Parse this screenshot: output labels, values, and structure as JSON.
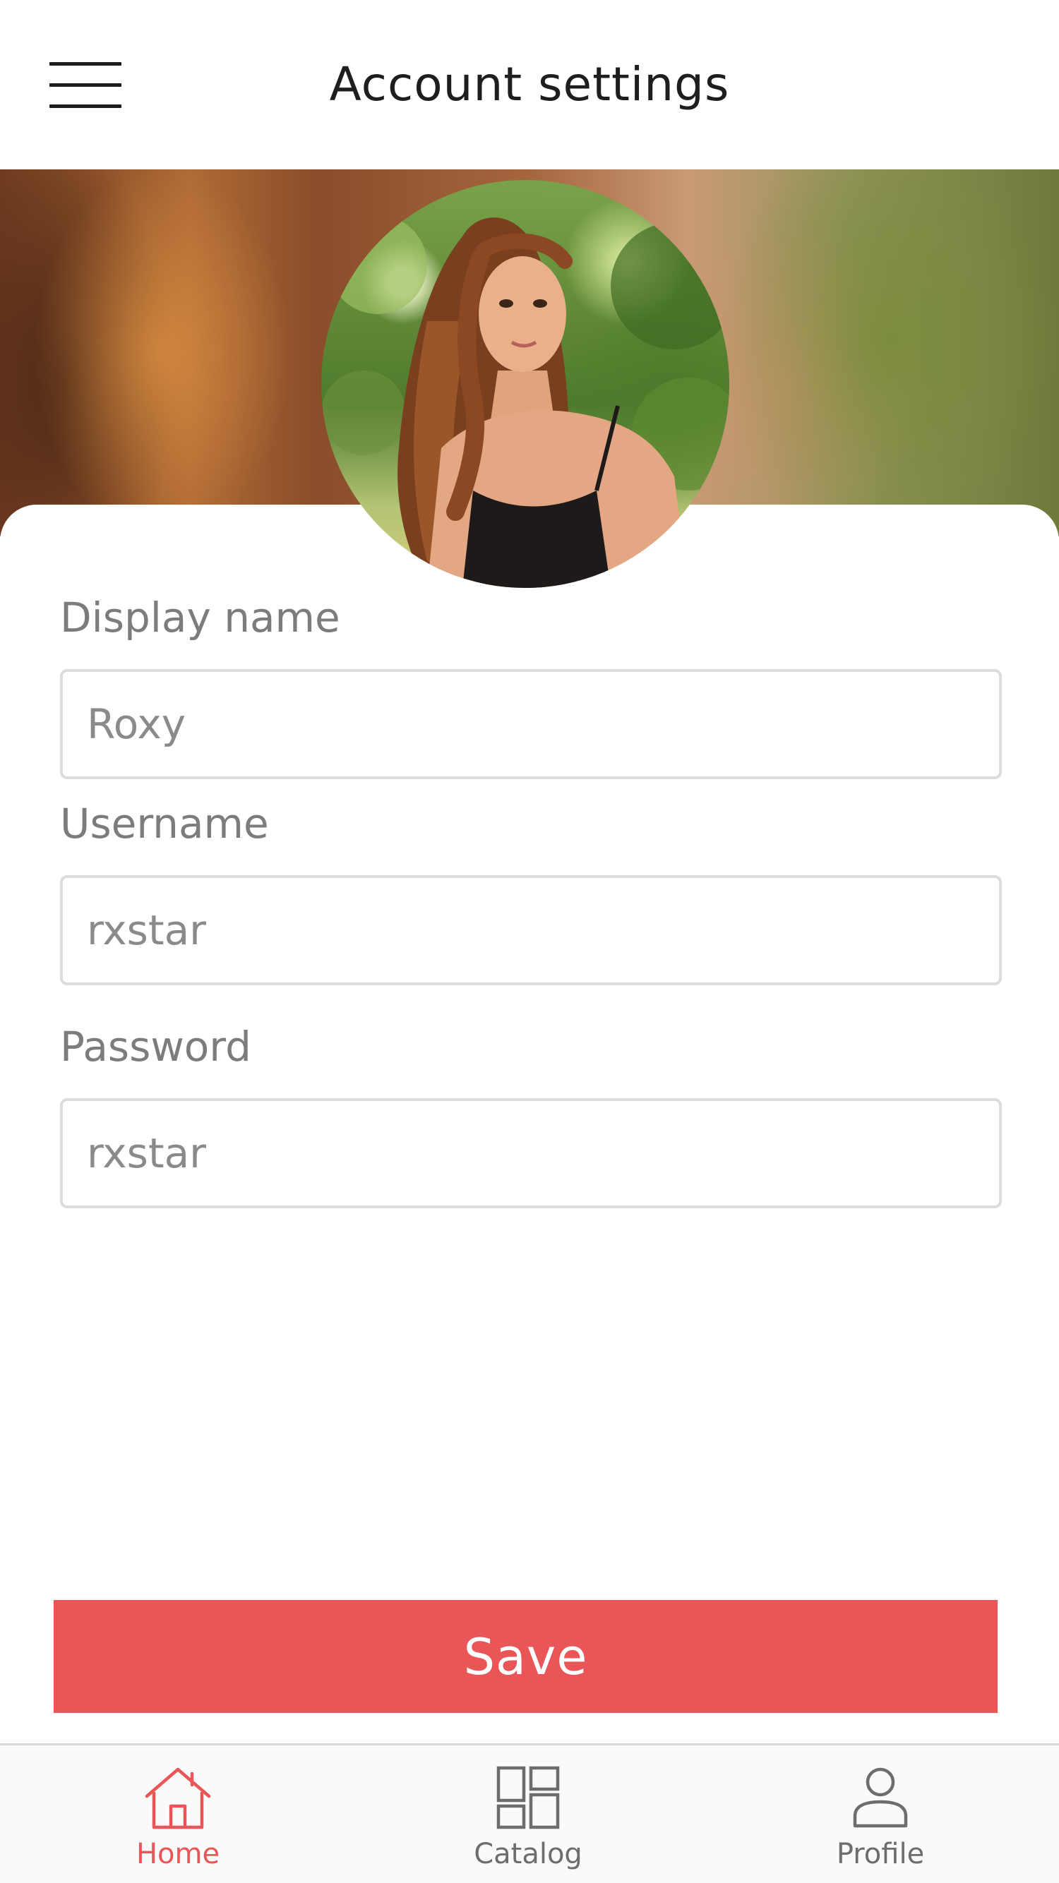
{
  "header": {
    "title": "Account settings",
    "menu_icon": "hamburger-menu-icon"
  },
  "profile": {
    "avatar_icon": "profile-photo"
  },
  "form": {
    "display_name": {
      "label": "Display name",
      "value": "Roxy"
    },
    "username": {
      "label": "Username",
      "value": "rxstar"
    },
    "password": {
      "label": "Password",
      "value": "rxstar"
    }
  },
  "actions": {
    "save_label": "Save"
  },
  "bottom_nav": {
    "items": [
      {
        "label": "Home",
        "icon": "home-icon",
        "active": true
      },
      {
        "label": "Catalog",
        "icon": "catalog-icon",
        "active": false
      },
      {
        "label": "Profile",
        "icon": "profile-icon",
        "active": false
      }
    ]
  },
  "colors": {
    "accent": "#ea5657",
    "nav_inactive": "#6d6d6d",
    "label": "#7c7c7c",
    "input_border": "#dcdcdc"
  }
}
